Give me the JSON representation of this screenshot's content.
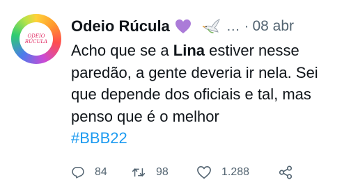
{
  "tweet": {
    "avatar": {
      "line1": "ODEIO",
      "line2": "RÚCULA"
    },
    "author": {
      "display_name": "Odeio Rúcula",
      "emoji": [
        "purple-heart",
        "dove"
      ],
      "ellipsis": "…",
      "separator": "·",
      "timestamp": "08 abr"
    },
    "text": {
      "part1": "Acho que se a ",
      "mention": "Lina",
      "part2": " estiver nesse paredão, a gente deveria ir nela. Sei que depende dos oficiais e tal, mas penso que é o melhor",
      "hashtag": "#BBB22"
    },
    "actions": {
      "replies": "84",
      "retweets": "98",
      "likes": "1.288"
    },
    "colors": {
      "text": "#0f1419",
      "secondary": "#536471",
      "hashtag": "#1d9bf0",
      "heart": "#ab7bd8"
    }
  }
}
